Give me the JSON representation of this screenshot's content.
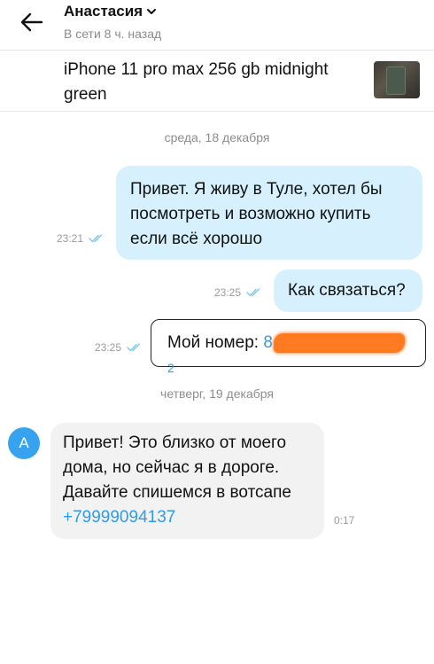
{
  "header": {
    "contact_name": "Анастасия",
    "status": "В сети 8 ч. назад"
  },
  "ad": {
    "title": "iPhone 11 pro max 256 gb midnight green"
  },
  "dates": {
    "first": "среда, 18 декабря",
    "second": "четверг, 19 декабря"
  },
  "messages": [
    {
      "text": "Привет. Я живу в Туле, хотел бы посмотреть и возможно купить если всё хорошо",
      "time": "23:21",
      "read": true,
      "direction": "out"
    },
    {
      "text": "Как связаться?",
      "time": "23:25",
      "read": true,
      "direction": "out"
    },
    {
      "label": "Мой номер: ",
      "phone_visible": "8",
      "phone_tail": "2",
      "time": "23:25",
      "read": true,
      "direction": "out"
    },
    {
      "lines": [
        "Привет! Это близко от моего",
        "дома, но сейчас я в дороге.",
        "Давайте спишемся в вотсапе"
      ],
      "phone": "+79999094137",
      "time": "0:17",
      "direction": "in",
      "sender_initial": "А"
    }
  ],
  "colors": {
    "out_bubble": "#d6f1fd",
    "in_bubble": "#f2f2f2",
    "link": "#2f9be8",
    "avatar": "#36a2f0",
    "redaction": "#ff7a21"
  }
}
